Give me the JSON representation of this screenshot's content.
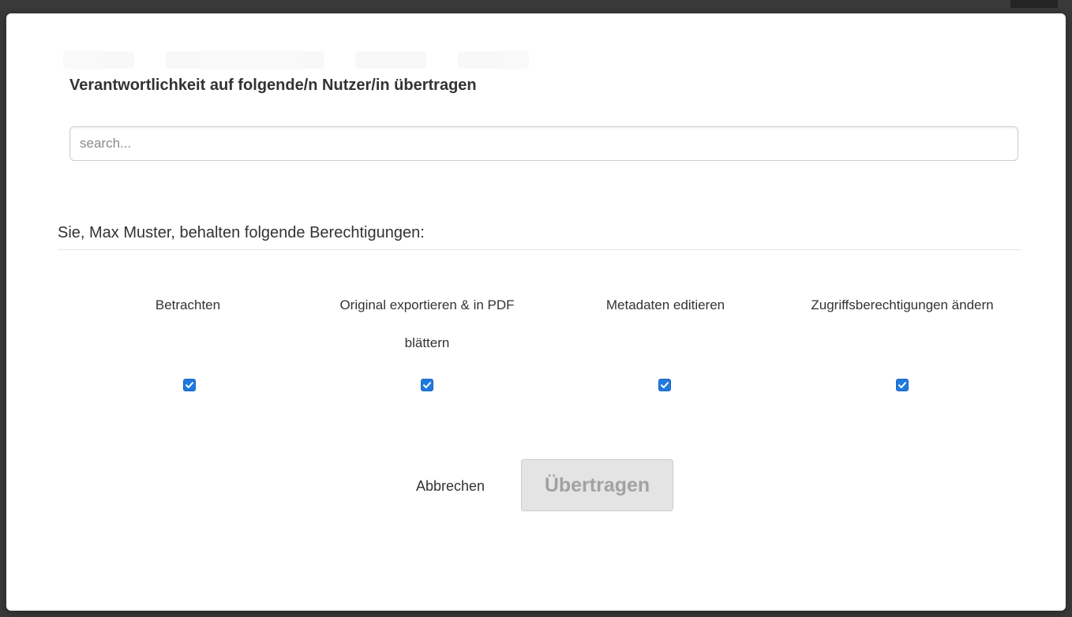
{
  "modal": {
    "title": "Verantwortlichkeit auf folgende/n Nutzer/in übertragen",
    "search": {
      "placeholder": "search...",
      "value": ""
    },
    "permissions_heading": "Sie, Max Muster, behalten folgende Berechtigungen:",
    "permissions": [
      {
        "label": "Betrachten",
        "checked": true
      },
      {
        "label": "Original exportieren & in PDF blättern",
        "checked": true
      },
      {
        "label": "Metadaten editieren",
        "checked": true
      },
      {
        "label": "Zugriffsberechtigungen ändern",
        "checked": true
      }
    ],
    "footer": {
      "cancel_label": "Abbrechen",
      "submit_label": "Übertragen",
      "submit_disabled": true
    }
  },
  "colors": {
    "checkbox_accent": "#1f7ae0",
    "disabled_button_bg": "#e4e4e4",
    "disabled_button_text": "#a2a2a2"
  }
}
